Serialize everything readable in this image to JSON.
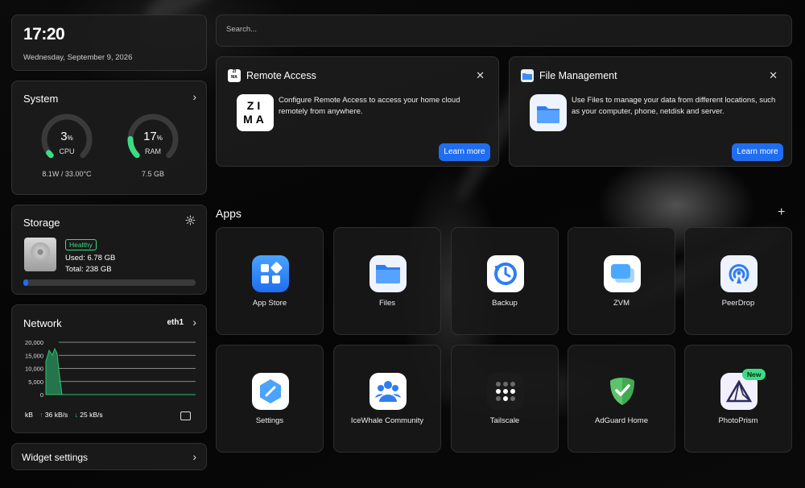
{
  "clock": {
    "time": "17:20",
    "date": "Wednesday, September 9, 2026"
  },
  "system": {
    "title": "System",
    "cpu": {
      "value": "3",
      "unit": "%",
      "label": "CPU",
      "detail": "8.1W / 33.00°C",
      "percent": 3
    },
    "ram": {
      "value": "17",
      "unit": "%",
      "label": "RAM",
      "detail": "7.5 GB",
      "percent": 17
    }
  },
  "storage": {
    "title": "Storage",
    "status": "Healthy",
    "used": "Used: 6.78 GB",
    "total": "Total: 238 GB",
    "used_fraction": 0.028
  },
  "network": {
    "title": "Network",
    "interface": "eth1",
    "y_ticks": [
      "20,000",
      "15,000",
      "10,000",
      "5,000",
      "0"
    ],
    "unit": "kB",
    "up": "36 kB/s",
    "down": "25 kB/s"
  },
  "widget_settings": {
    "label": "Widget settings"
  },
  "search": {
    "placeholder": "Search..."
  },
  "notices": [
    {
      "title": "Remote Access",
      "text": "Configure Remote Access to access your home cloud remotely from anywhere.",
      "button": "Learn more",
      "logo_text": "ZIMA"
    },
    {
      "title": "File Management",
      "text": "Use Files to manage your data from different locations, such as your computer, phone, netdisk and server.",
      "button": "Learn more"
    }
  ],
  "apps_section": {
    "title": "Apps",
    "add": "+"
  },
  "apps": [
    {
      "name": "App Store",
      "icon": "app-store-icon"
    },
    {
      "name": "Files",
      "icon": "folder-icon"
    },
    {
      "name": "Backup",
      "icon": "backup-icon"
    },
    {
      "name": "ZVM",
      "icon": "zvm-icon"
    },
    {
      "name": "PeerDrop",
      "icon": "peerdrop-icon"
    },
    {
      "name": "Settings",
      "icon": "settings-icon"
    },
    {
      "name": "IceWhale Community",
      "icon": "community-icon"
    },
    {
      "name": "Tailscale",
      "icon": "tailscale-icon"
    },
    {
      "name": "AdGuard Home",
      "icon": "adguard-icon"
    },
    {
      "name": "PhotoPrism",
      "icon": "photoprism-icon",
      "badge": "New"
    }
  ],
  "colors": {
    "accent": "#1f6df0",
    "healthy": "#3ddc84",
    "gauge": "#3ddc84",
    "chart": "#2fbf74"
  }
}
